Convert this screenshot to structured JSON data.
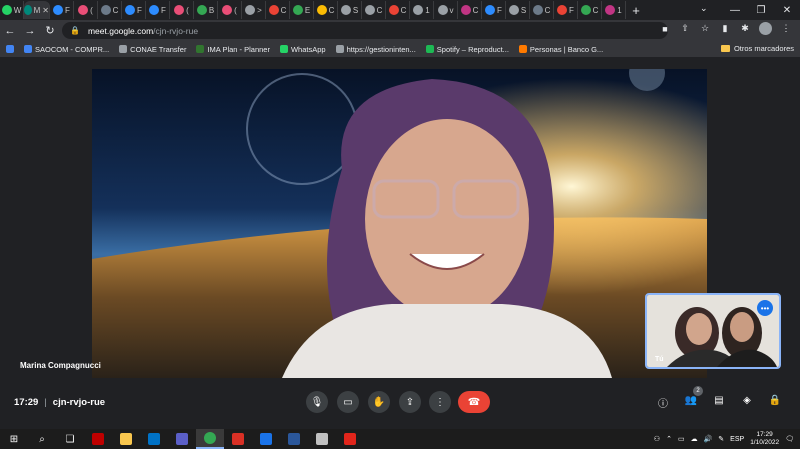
{
  "browser": {
    "tabs": [
      {
        "label": "W",
        "color": "#25d366",
        "active": false
      },
      {
        "label": "M",
        "color": "#00897b",
        "active": true
      },
      {
        "label": "F",
        "color": "#2d8cff",
        "active": false
      },
      {
        "label": "(",
        "color": "#e94e77",
        "active": false
      },
      {
        "label": "C",
        "color": "#6c7a89",
        "active": false
      },
      {
        "label": "F",
        "color": "#2d8cff",
        "active": false
      },
      {
        "label": "F",
        "color": "#2d8cff",
        "active": false
      },
      {
        "label": "(",
        "color": "#e94e77",
        "active": false
      },
      {
        "label": "B",
        "color": "#34a853",
        "active": false
      },
      {
        "label": "(",
        "color": "#e94e77",
        "active": false
      },
      {
        "label": ">",
        "color": "#9aa0a6",
        "active": false
      },
      {
        "label": "C",
        "color": "#ea4335",
        "active": false
      },
      {
        "label": "E",
        "color": "#34a853",
        "active": false
      },
      {
        "label": "C",
        "color": "#fbbc04",
        "active": false
      },
      {
        "label": "S",
        "color": "#9aa0a6",
        "active": false
      },
      {
        "label": "C",
        "color": "#9aa0a6",
        "active": false
      },
      {
        "label": "C",
        "color": "#ea4335",
        "active": false
      },
      {
        "label": "1",
        "color": "#9aa0a6",
        "active": false
      },
      {
        "label": "v",
        "color": "#9aa0a6",
        "active": false
      },
      {
        "label": "C",
        "color": "#c13584",
        "active": false
      },
      {
        "label": "F",
        "color": "#2d8cff",
        "active": false
      },
      {
        "label": "S",
        "color": "#9aa0a6",
        "active": false
      },
      {
        "label": "C",
        "color": "#6c7a89",
        "active": false
      },
      {
        "label": "F",
        "color": "#ea4335",
        "active": false
      },
      {
        "label": "C",
        "color": "#34a853",
        "active": false
      },
      {
        "label": "1",
        "color": "#c13584",
        "active": false
      }
    ],
    "new_tab_label": "+",
    "url_host": "meet.google.com",
    "url_path": "/cjn-rvjo-rue",
    "bookmarks": [
      {
        "label": "SAOCOM - COMPR...",
        "color": "#4285f4"
      },
      {
        "label": "CONAE Transfer",
        "color": "#9aa0a6"
      },
      {
        "label": "IMA Plan - Planner",
        "color": "#31752f"
      },
      {
        "label": "WhatsApp",
        "color": "#25d366"
      },
      {
        "label": "https://gestioninten...",
        "color": "#9aa0a6"
      },
      {
        "label": "Spotify – Reproduct...",
        "color": "#1db954"
      },
      {
        "label": "Personas | Banco G...",
        "color": "#ff7a00"
      }
    ],
    "other_bookmarks": "Otros marcadores"
  },
  "meet": {
    "participant_name": "Marina Compagnucci",
    "self_label": "Tú",
    "time": "17:29",
    "meeting_code": "cjn-rvjo-rue",
    "participants_count": "2"
  },
  "taskbar": {
    "language": "ESP",
    "clock_time": "17:29",
    "clock_date": "1/10/2022"
  },
  "colors": {
    "end_call": "#ea4335",
    "meet_bg": "#202124",
    "accent": "#8ab4f8"
  }
}
